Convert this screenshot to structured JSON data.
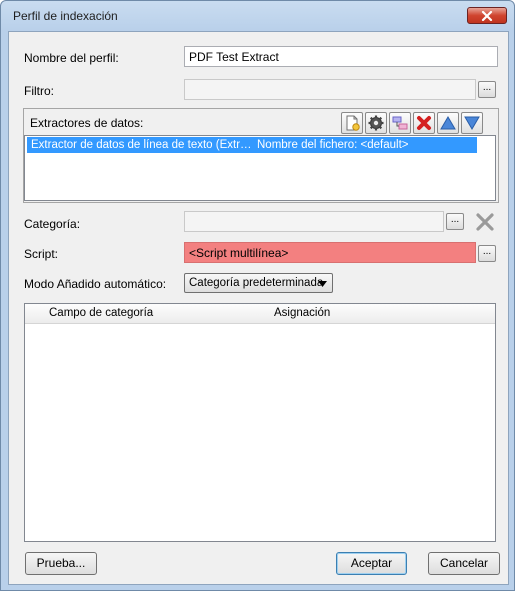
{
  "window": {
    "title": "Perfil de indexación"
  },
  "profile_name": {
    "label": "Nombre del perfil:",
    "value": "PDF Test Extract"
  },
  "filter": {
    "label": "Filtro:",
    "value": "",
    "browse_label": "..."
  },
  "extractors": {
    "label": "Extractores de datos:",
    "toolbar": {
      "add_icon": "new-document-icon",
      "settings_icon": "gear-icon",
      "link_icon": "link-icon",
      "delete_icon": "red-x-icon",
      "up_icon": "move-up-icon",
      "down_icon": "move-down-icon"
    },
    "items": [
      {
        "name": "Extractor de datos de línea de texto (Extr…",
        "detail": "Nombre del fichero: <default>"
      }
    ]
  },
  "category": {
    "label": "Categoría:",
    "value": "",
    "browse_label": "..."
  },
  "script": {
    "label": "Script:",
    "value": "<Script multilínea>",
    "browse_label": "..."
  },
  "auto_add": {
    "label": "Modo Añadido automático:",
    "selected": "Categoría predeterminada"
  },
  "mapping_grid": {
    "columns": [
      "Campo de categoría",
      "Asignación"
    ],
    "rows": []
  },
  "buttons": {
    "test": "Prueba...",
    "accept": "Aceptar",
    "cancel": "Cancelar"
  },
  "colors": {
    "selection": "#3399ff",
    "script_error": "#f38080",
    "close": "#c74632"
  }
}
